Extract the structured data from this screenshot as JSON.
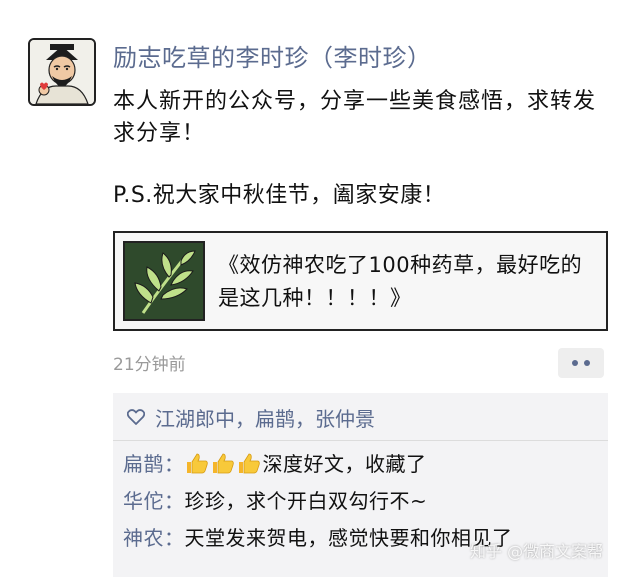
{
  "post": {
    "author_name": "励志吃草的李时珍（李时珍）",
    "body_text": "本人新开的公众号，分享一些美食感悟，求转发求分享！",
    "ps_text": "P.S.祝大家中秋佳节，阖家安康！",
    "shared_link_title": "《效仿神农吃了100种药草，最好吃的是这几种！！！！》",
    "timestamp": "21分钟前"
  },
  "likes": {
    "names": "江湖郎中，扁鹊，张仲景"
  },
  "comments": [
    {
      "name": "扁鹊",
      "sep": "：",
      "emoji_count": 3,
      "text": "深度好文，收藏了"
    },
    {
      "name": "华佗",
      "sep": "：",
      "text": "珍珍，求个开白双勾行不~"
    },
    {
      "name": "神农",
      "sep": "：",
      "text": "天堂发来贺电，感觉快要和你相见了"
    }
  ],
  "watermark": "知乎 @微商文案帮",
  "colors": {
    "name_blue": "#5b6b8f",
    "comment_bg": "#f3f3f5",
    "time_gray": "#9a9a9a"
  },
  "icons": {
    "like": "heart-outline-icon",
    "more": "more-dots-icon",
    "thumbs": "thumbs-up-emoji"
  }
}
